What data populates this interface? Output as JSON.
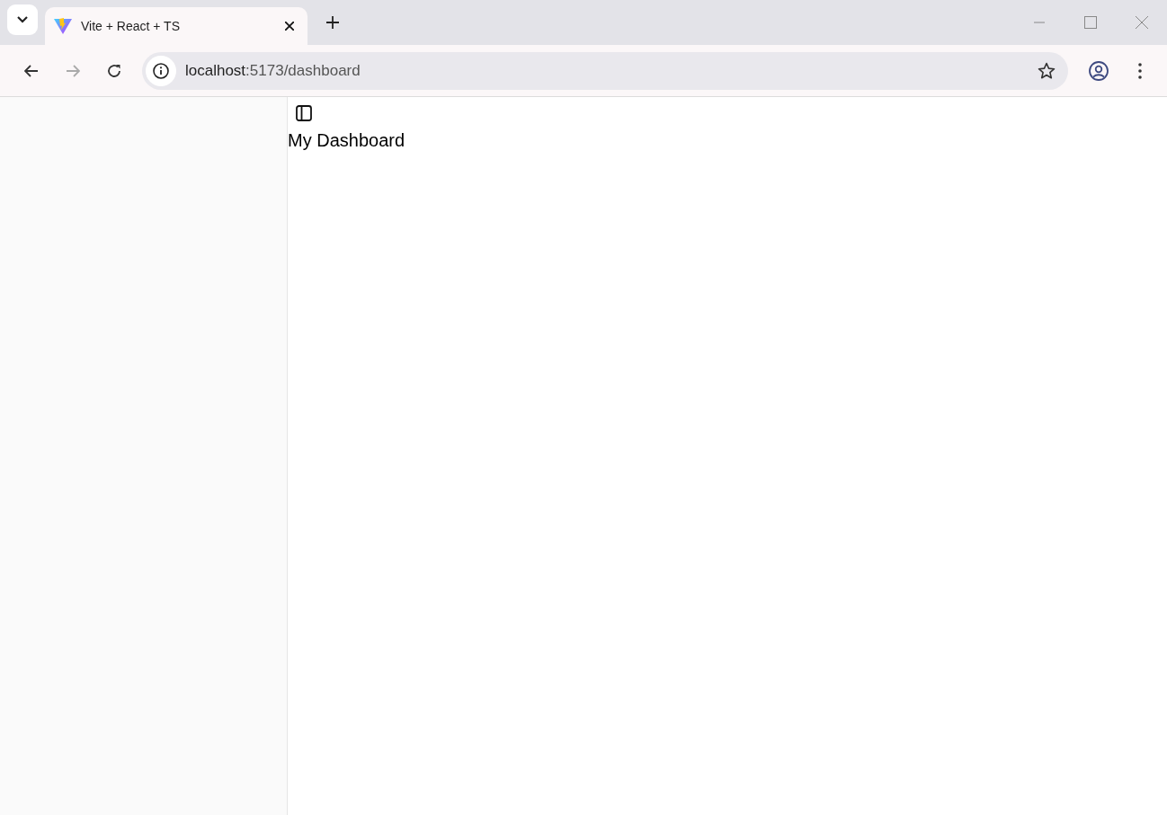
{
  "browser": {
    "tabs": [
      {
        "title": "Vite + React + TS",
        "selected": true
      }
    ],
    "address": {
      "host": "localhost",
      "path": ":5173/dashboard"
    }
  },
  "page": {
    "title": "My Dashboard"
  }
}
